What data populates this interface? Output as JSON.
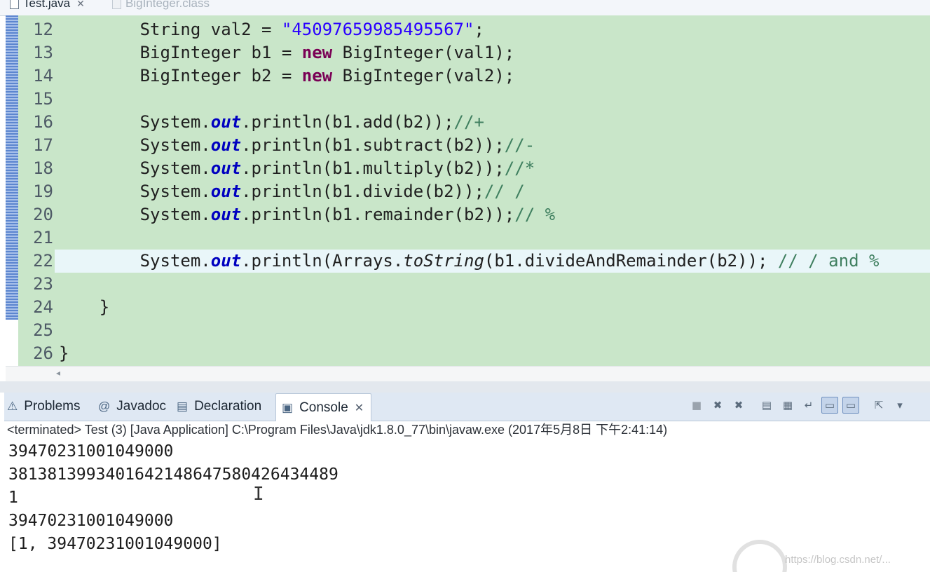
{
  "editor_tabs": [
    {
      "label": "Test.java",
      "active": true
    },
    {
      "label": "BigInteger.class",
      "active": false
    }
  ],
  "editor": {
    "current_line": 22,
    "lines": [
      {
        "num": "12",
        "tokens": [
          {
            "t": "        String ",
            "c": "plain"
          },
          {
            "t": "val2",
            "c": "plain"
          },
          {
            "t": " = ",
            "c": "plain"
          },
          {
            "t": "\"45097659985495567\"",
            "c": "str"
          },
          {
            "t": ";",
            "c": "plain"
          }
        ]
      },
      {
        "num": "13",
        "tokens": [
          {
            "t": "        BigInteger b1 = ",
            "c": "plain"
          },
          {
            "t": "new",
            "c": "kw"
          },
          {
            "t": " BigInteger(val1);",
            "c": "plain"
          }
        ]
      },
      {
        "num": "14",
        "tokens": [
          {
            "t": "        BigInteger b2 = ",
            "c": "plain"
          },
          {
            "t": "new",
            "c": "kw"
          },
          {
            "t": " BigInteger(val2);",
            "c": "plain"
          }
        ]
      },
      {
        "num": "15",
        "tokens": []
      },
      {
        "num": "16",
        "tokens": [
          {
            "t": "        System.",
            "c": "plain"
          },
          {
            "t": "out",
            "c": "fld"
          },
          {
            "t": ".println(b1.add(b2));",
            "c": "plain"
          },
          {
            "t": "//+",
            "c": "cmt"
          }
        ]
      },
      {
        "num": "17",
        "tokens": [
          {
            "t": "        System.",
            "c": "plain"
          },
          {
            "t": "out",
            "c": "fld"
          },
          {
            "t": ".println(b1.subtract(b2));",
            "c": "plain"
          },
          {
            "t": "//-",
            "c": "cmt"
          }
        ]
      },
      {
        "num": "18",
        "tokens": [
          {
            "t": "        System.",
            "c": "plain"
          },
          {
            "t": "out",
            "c": "fld"
          },
          {
            "t": ".println(b1.multiply(b2));",
            "c": "plain"
          },
          {
            "t": "//*",
            "c": "cmt"
          }
        ]
      },
      {
        "num": "19",
        "tokens": [
          {
            "t": "        System.",
            "c": "plain"
          },
          {
            "t": "out",
            "c": "fld"
          },
          {
            "t": ".println(b1.divide(b2));",
            "c": "plain"
          },
          {
            "t": "// /",
            "c": "cmt"
          }
        ]
      },
      {
        "num": "20",
        "tokens": [
          {
            "t": "        System.",
            "c": "plain"
          },
          {
            "t": "out",
            "c": "fld"
          },
          {
            "t": ".println(b1.remainder(b2));",
            "c": "plain"
          },
          {
            "t": "// %",
            "c": "cmt"
          }
        ]
      },
      {
        "num": "21",
        "tokens": []
      },
      {
        "num": "22",
        "tokens": [
          {
            "t": "        System.",
            "c": "plain"
          },
          {
            "t": "out",
            "c": "fld"
          },
          {
            "t": ".println(Arrays.",
            "c": "plain"
          },
          {
            "t": "toString",
            "c": "ital"
          },
          {
            "t": "(b1.divideAndRemainder(b2)); ",
            "c": "plain"
          },
          {
            "t": "// / and %",
            "c": "cmt"
          }
        ]
      },
      {
        "num": "23",
        "tokens": []
      },
      {
        "num": "24",
        "tokens": [
          {
            "t": "    }",
            "c": "plain"
          }
        ]
      },
      {
        "num": "25",
        "tokens": []
      },
      {
        "num": "26",
        "tokens": [
          {
            "t": "}",
            "c": "plain"
          }
        ]
      }
    ]
  },
  "view_tabs": [
    {
      "label": "Problems",
      "icon": "problems-icon",
      "glyph": "⚠"
    },
    {
      "label": "Javadoc",
      "icon": "javadoc-icon",
      "glyph": "@"
    },
    {
      "label": "Declaration",
      "icon": "declaration-icon",
      "glyph": "▤"
    },
    {
      "label": "Console",
      "icon": "console-icon",
      "glyph": "▣",
      "active": true
    }
  ],
  "console_toolbar": [
    {
      "name": "terminate-icon",
      "glyph": "■",
      "style": "grey"
    },
    {
      "name": "remove-launch-icon",
      "glyph": "✖",
      "style": "plain"
    },
    {
      "name": "remove-all-terminated-icon",
      "glyph": "✖",
      "style": "plain"
    },
    {
      "name": "clear-console-icon",
      "glyph": "▤",
      "style": "gap"
    },
    {
      "name": "scroll-lock-icon",
      "glyph": "▦",
      "style": "plain"
    },
    {
      "name": "word-wrap-icon",
      "glyph": "↵",
      "style": "plain"
    },
    {
      "name": "show-on-stdout-icon",
      "glyph": "▭",
      "style": "pressed"
    },
    {
      "name": "show-on-stderr-icon",
      "glyph": "▭",
      "style": "pressed"
    },
    {
      "name": "pin-console-icon",
      "glyph": "⇱",
      "style": "gap"
    },
    {
      "name": "display-console-icon",
      "glyph": "▾",
      "style": "plain"
    }
  ],
  "console": {
    "status": "<terminated> Test (3) [Java Application] C:\\Program Files\\Java\\jdk1.8.0_77\\bin\\javaw.exe (2017年5月8日 下午2:41:14)",
    "output": [
      "39470231001049000",
      "3813813993401642148647580426434489",
      "1",
      "39470231001049000",
      "[1, 39470231001049000]"
    ]
  },
  "watermark": "https://blog.csdn.net/...",
  "colors": {
    "editor_bg": "#c9e6c9",
    "current_line": "#e9f6f9",
    "keyword": "#7a0055",
    "string": "#2a00ff",
    "field": "#0000c0",
    "comment": "#3f7f5f"
  }
}
